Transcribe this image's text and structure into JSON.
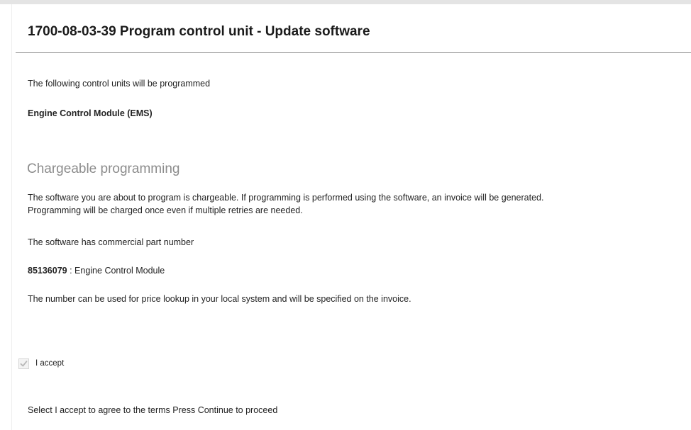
{
  "header": {
    "title": "1700-08-03-39 Program control unit - Update software"
  },
  "intro": {
    "line": "The following control units will be programmed",
    "control_unit": "Engine Control Module (EMS)"
  },
  "chargeable": {
    "heading": "Chargeable programming",
    "paragraph_line1": "The software you are about to program is chargeable. If programming is performed using the software, an invoice will be generated.",
    "paragraph_line2": "Programming will be charged once even if multiple retries are needed.",
    "part_number_intro": "The software has commercial part number",
    "part_number": "85136079",
    "part_description": " : Engine Control Module",
    "price_lookup_note": "The number can be used for price lookup in your local system and will be specified on the invoice."
  },
  "accept": {
    "checked": true,
    "label": "I accept",
    "icon": "checkmark-icon"
  },
  "footer": {
    "instruction": "Select I accept to agree to the terms Press Continue to proceed"
  },
  "colors": {
    "title_text": "#1a1a1a",
    "section_heading": "#8c8c8c",
    "divider": "#8a8a8a",
    "checkmark": "#b8b8b8"
  }
}
